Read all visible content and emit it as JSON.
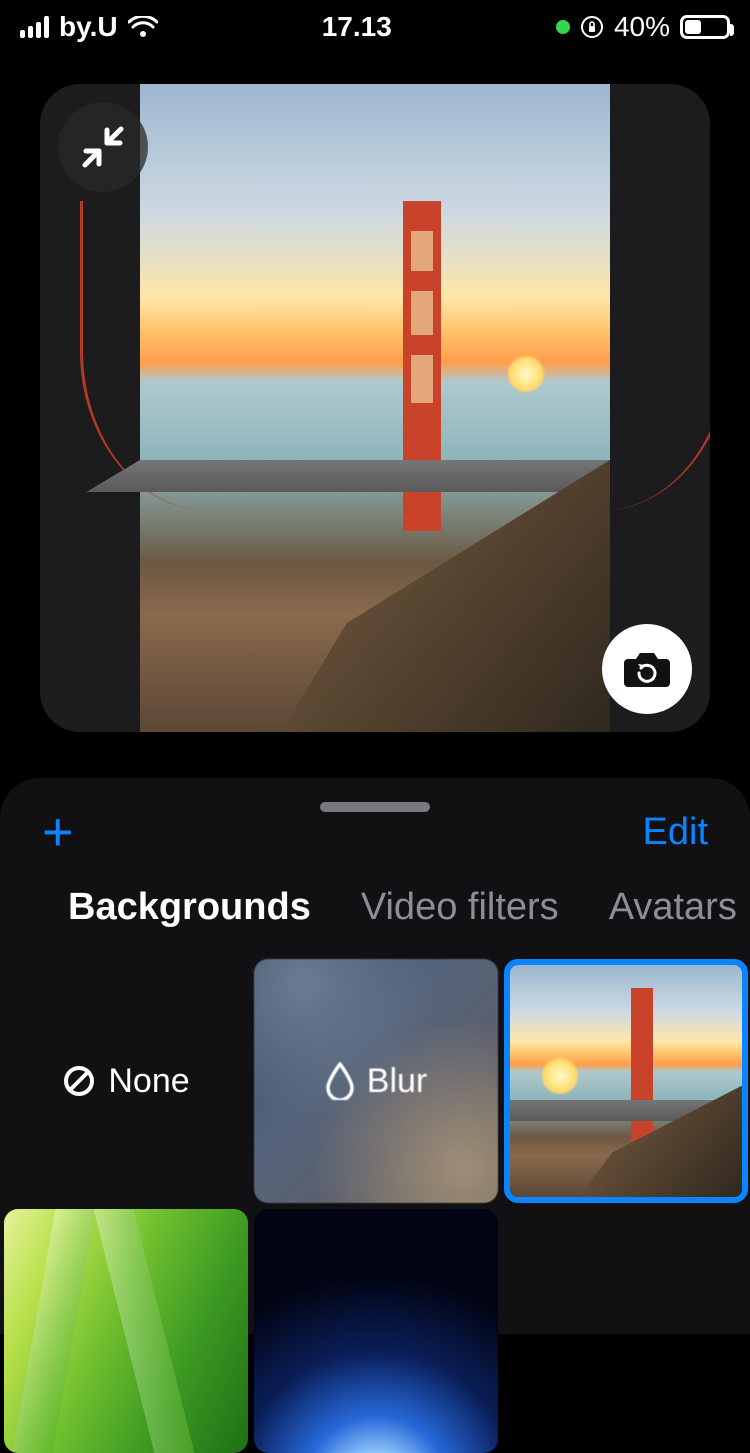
{
  "statusbar": {
    "carrier": "by.U",
    "time": "17.13",
    "battery_text": "40%",
    "battery_pct": 40
  },
  "sheet": {
    "edit_label": "Edit"
  },
  "tabs": [
    {
      "label": "Backgrounds",
      "active": true
    },
    {
      "label": "Video filters",
      "active": false
    },
    {
      "label": "Avatars",
      "active": false
    }
  ],
  "backgrounds": {
    "none_label": "None",
    "blur_label": "Blur",
    "selected_index": 2
  },
  "colors": {
    "accent": "#0a84ff"
  }
}
